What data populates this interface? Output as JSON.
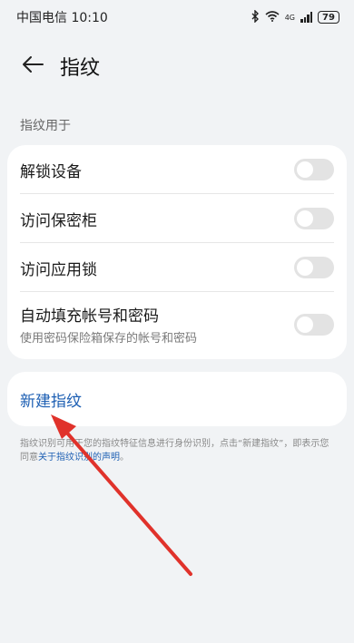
{
  "status_bar": {
    "carrier": "中国电信",
    "time": "10:10",
    "network": "4G",
    "battery": "79"
  },
  "header": {
    "title": "指纹"
  },
  "section": {
    "label": "指纹用于"
  },
  "settings": [
    {
      "label": "解锁设备",
      "toggle_on": false
    },
    {
      "label": "访问保密柜",
      "toggle_on": false
    },
    {
      "label": "访问应用锁",
      "toggle_on": false
    },
    {
      "label": "自动填充帐号和密码",
      "sublabel": "使用密码保险箱保存的帐号和密码",
      "toggle_on": false
    }
  ],
  "new_fingerprint": {
    "label": "新建指纹"
  },
  "footnote": {
    "text_a": "指纹识别可用于您的指纹特征信息进行身份识别，点击“新建指纹”，即表示您同意",
    "link": "关于指纹识别的声明",
    "text_b": "。"
  },
  "colors": {
    "accent": "#1d5fb3",
    "annotation_arrow": "#e0322b",
    "background": "#f1f3f5"
  }
}
